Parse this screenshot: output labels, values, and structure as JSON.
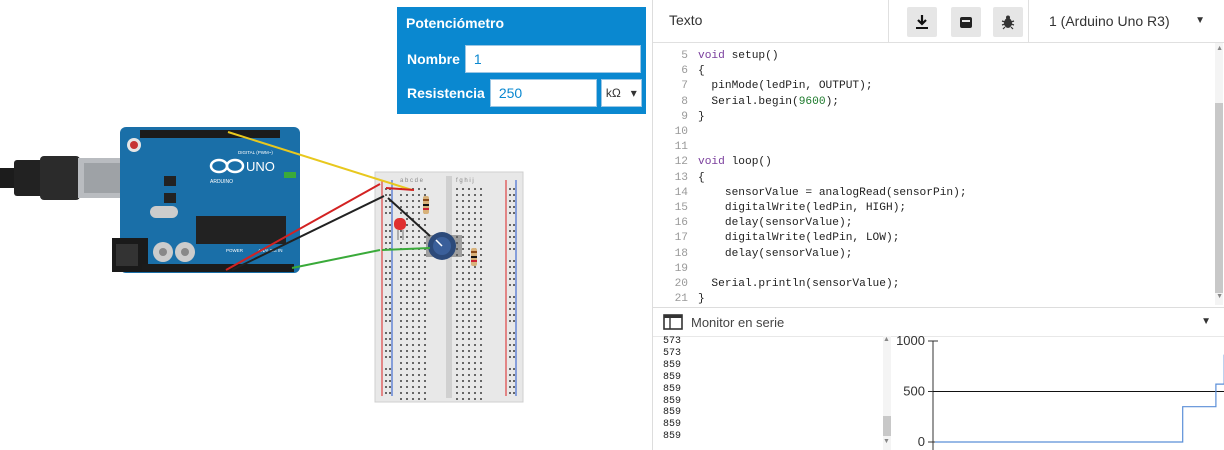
{
  "inspector": {
    "title": "Potenciómetro",
    "name_label": "Nombre",
    "name_value": "1",
    "resistance_label": "Resistencia",
    "resistance_value": "250",
    "unit": "kΩ"
  },
  "circuit": {
    "board_text": "UNO",
    "board_brand": "ARDUINO",
    "digital_label": "DIGITAL (PWM~)",
    "power_label": "POWER",
    "analog_label": "ANALOG IN",
    "breadboard_cols_left": "a b c d e",
    "breadboard_cols_right": "f g h i j"
  },
  "toolbar": {
    "mode_label": "Texto",
    "download_icon": "download-icon",
    "upload_icon": "upload-icon",
    "debug_icon": "bug-icon",
    "board_select": "1 (Arduino Uno R3)"
  },
  "code": [
    {
      "n": "5",
      "t": "void setup()"
    },
    {
      "n": "6",
      "t": "{"
    },
    {
      "n": "7",
      "t": "  pinMode(ledPin, OUTPUT);"
    },
    {
      "n": "8",
      "t": "  Serial.begin(9600);"
    },
    {
      "n": "9",
      "t": "}"
    },
    {
      "n": "10",
      "t": ""
    },
    {
      "n": "11",
      "t": ""
    },
    {
      "n": "12",
      "t": "void loop()"
    },
    {
      "n": "13",
      "t": "{"
    },
    {
      "n": "14",
      "t": "    sensorValue = analogRead(sensorPin);"
    },
    {
      "n": "15",
      "t": "    digitalWrite(ledPin, HIGH);"
    },
    {
      "n": "16",
      "t": "    delay(sensorValue);"
    },
    {
      "n": "17",
      "t": "    digitalWrite(ledPin, LOW);"
    },
    {
      "n": "18",
      "t": "    delay(sensorValue);"
    },
    {
      "n": "19",
      "t": ""
    },
    {
      "n": "20",
      "t": "  Serial.println(sensorValue);"
    },
    {
      "n": "21",
      "t": "}"
    }
  ],
  "serial": {
    "title": "Monitor en serie",
    "lines": [
      "573",
      "573",
      "859",
      "859",
      "859",
      "859",
      "859",
      "859",
      "859"
    ]
  },
  "chart_data": {
    "type": "line",
    "title": "",
    "xlabel": "",
    "ylabel": "",
    "ylim": [
      0,
      1000
    ],
    "yticks": [
      "1000",
      "500",
      "0"
    ],
    "series": [
      {
        "values": [
          0,
          0,
          0,
          0,
          0,
          0,
          0,
          0,
          0,
          0,
          0,
          0,
          0,
          0,
          0,
          0,
          0,
          0,
          0,
          0,
          0,
          0,
          0,
          0,
          0,
          0,
          0,
          0,
          0,
          0,
          0,
          0,
          0,
          0,
          0,
          0,
          0,
          0,
          0,
          0,
          0,
          0,
          0,
          0,
          0,
          0,
          0,
          0,
          0,
          0,
          0,
          0,
          0,
          0,
          0,
          0,
          0,
          0,
          0,
          0,
          0,
          0,
          0,
          0,
          0,
          0,
          0,
          0,
          0,
          0,
          0,
          0,
          0,
          0,
          0,
          0,
          0,
          0,
          0,
          0,
          0,
          0,
          0,
          0,
          0,
          0,
          0,
          0,
          0,
          0,
          0,
          0,
          0,
          0,
          0,
          0,
          0,
          0,
          0,
          0,
          0,
          0,
          0,
          0,
          0,
          0,
          0,
          0,
          0,
          0,
          0,
          0,
          0,
          0,
          0,
          0,
          0,
          0,
          0,
          0,
          0,
          0,
          0,
          0,
          0,
          0,
          0,
          0,
          0,
          0,
          0,
          0,
          0,
          0,
          0,
          0,
          0,
          0,
          0,
          0,
          0,
          0,
          0,
          0,
          0,
          0,
          0,
          0,
          0,
          0,
          0,
          0,
          0,
          0,
          0,
          0,
          0,
          0,
          0,
          0,
          0,
          0,
          0,
          0,
          0,
          0,
          0,
          0,
          0,
          0,
          0,
          0,
          0,
          0,
          0,
          0,
          0,
          0,
          0,
          0,
          0,
          0,
          0,
          0,
          0,
          0,
          0,
          0,
          0,
          0,
          0,
          0,
          0,
          0,
          0,
          0,
          0,
          0,
          0,
          0,
          0,
          0,
          0,
          0,
          0,
          0,
          0,
          0,
          0,
          0,
          0,
          0,
          0,
          0,
          0,
          0,
          0,
          0,
          0,
          0,
          0,
          0,
          0,
          0,
          0,
          0,
          0,
          0,
          0,
          0,
          0,
          0,
          0,
          0,
          0,
          0,
          0,
          0,
          0,
          0,
          0,
          0,
          0,
          0,
          0,
          0,
          0,
          0,
          0,
          0,
          0,
          0,
          0,
          0,
          0,
          0,
          0,
          0,
          0,
          0,
          0,
          0,
          0,
          0,
          0,
          0,
          0,
          0,
          0,
          0,
          0,
          0,
          0,
          0,
          0,
          0,
          0,
          0,
          0,
          0,
          0,
          0,
          0,
          0,
          0,
          0,
          0,
          0,
          0,
          0,
          0,
          0,
          0,
          0,
          0,
          0,
          0,
          0,
          0,
          350,
          350,
          350,
          350,
          350,
          350,
          350,
          350,
          350,
          350,
          350,
          350,
          350,
          350,
          350,
          350,
          350,
          350,
          350,
          350,
          350,
          350,
          350,
          350,
          350,
          350,
          350,
          350,
          350,
          350,
          350,
          350,
          350,
          350,
          350,
          350,
          350,
          350,
          350,
          350,
          573,
          573,
          573,
          573,
          573,
          573,
          573,
          573,
          573,
          573,
          859,
          859
        ]
      }
    ]
  },
  "colors": {
    "accent": "#0a88d0",
    "board": "#1a6fa8",
    "plot_line": "#5b8fd8",
    "wire_red": "#d32222",
    "wire_yellow": "#e8c81e",
    "wire_green": "#3aaa3a",
    "wire_black": "#222222"
  }
}
